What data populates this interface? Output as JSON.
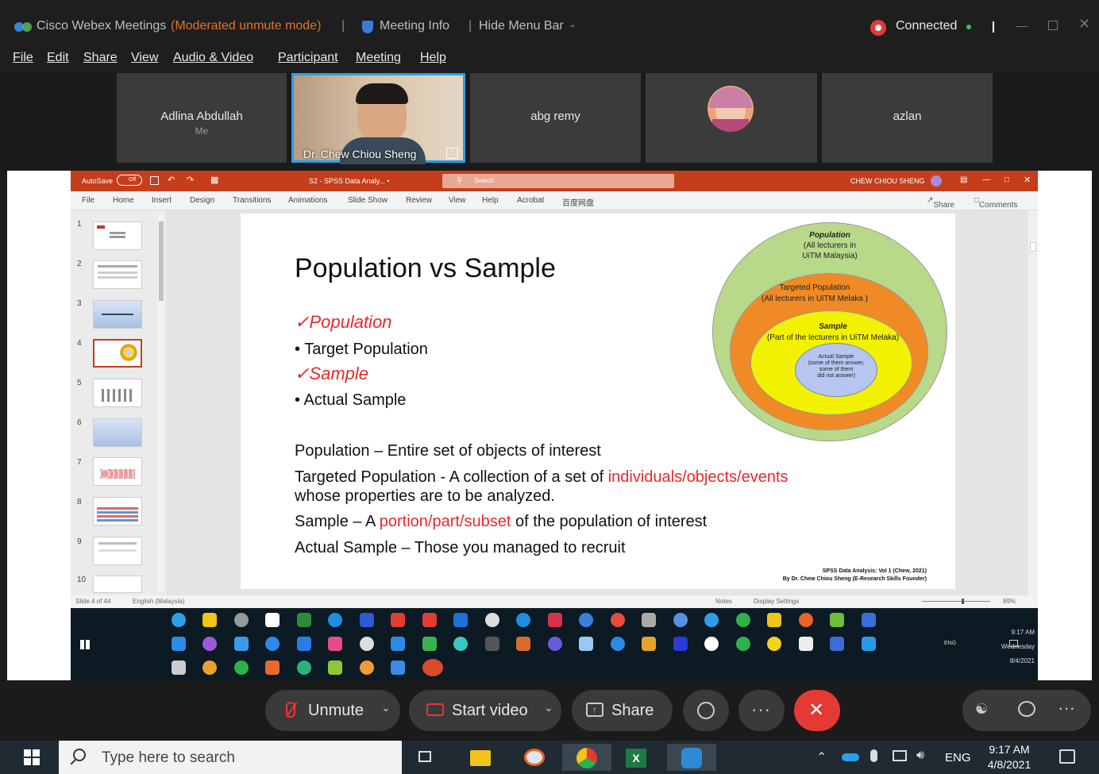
{
  "window": {
    "app_title": "Cisco Webex Meetings",
    "mode": "(Moderated unmute mode)",
    "meeting_info": "Meeting Info",
    "hide_menu_bar": "Hide Menu Bar",
    "connected": "Connected"
  },
  "menu": [
    "File",
    "Edit",
    "Share",
    "View",
    "Audio & Video",
    "Participant",
    "Meeting",
    "Help"
  ],
  "participants": [
    {
      "name": "Adlina Abdullah",
      "sub": "Me"
    },
    {
      "name": "Dr. Chew Chiou Sheng",
      "sub": ""
    },
    {
      "name": "abg remy",
      "sub": ""
    },
    {
      "name": "",
      "sub": ""
    },
    {
      "name": "azlan",
      "sub": ""
    }
  ],
  "powerpoint": {
    "autosave": "AutoSave",
    "autosave_state": "Off",
    "doc_title": "S2 - SPSS Data Analy... •",
    "search": "Search",
    "user": "CHEW CHIOU SHENG",
    "share": "Share",
    "comments": "Comments",
    "ribbon": [
      "File",
      "Home",
      "Insert",
      "Design",
      "Transitions",
      "Animations",
      "Slide Show",
      "Review",
      "View",
      "Help",
      "Acrobat",
      "百度网盘"
    ],
    "thumb_numbers": [
      "1",
      "2",
      "3",
      "4",
      "5",
      "6",
      "7",
      "8",
      "9",
      "10"
    ],
    "status_left": "Slide 4 of 44",
    "status_lang": "English (Malaysia)",
    "status_notes": "Notes",
    "status_display": "Display Settings",
    "zoom": "89%"
  },
  "slide": {
    "title": "Population vs Sample",
    "bullets": [
      {
        "mark": "✓",
        "text": "Population"
      },
      {
        "mark": "•",
        "text": "Target Population"
      },
      {
        "mark": "✓",
        "text": "Sample"
      },
      {
        "mark": "•",
        "text": "Actual Sample"
      }
    ],
    "def1": "Population – Entire set of objects of interest",
    "def2_a": "Targeted Population - A collection of a set of ",
    "def2_red": "individuals/objects/events",
    "def2_b": "whose properties are to be analyzed.",
    "def3_a": "Sample – A ",
    "def3_red": "portion/part/subset",
    "def3_b": " of the population of interest",
    "def4": "Actual Sample – Those you managed to recruit",
    "credit1": "SPSS Data Analysis: Vol 1 (Chew, 2021)",
    "credit2": "By Dr. Chew Chiou Sheng (E-Research Skills Founder)",
    "circle1_title": "Population",
    "circle1_sub1": "(All lecturers in",
    "circle1_sub2": "UiTM Malaysia)",
    "circle2_l1": "Targeted Population",
    "circle2_l2": "(All lecturers in UiTM Melaka )",
    "circle3_title": "Sample",
    "circle3_sub": "(Part of the lecturers in UiTM Melaka)",
    "circle4_l1": "Actual Sample",
    "circle4_l2": "(some of them answer,",
    "circle4_l3": "some of them",
    "circle4_l4": "did not answer)"
  },
  "remote_tray": {
    "time": "9:17 AM",
    "day": "Wednesday",
    "date": "8/4/2021",
    "lang": "ENG"
  },
  "controls": {
    "unmute": "Unmute",
    "start_video": "Start video",
    "share": "Share"
  },
  "taskbar": {
    "search_placeholder": "Type here to search",
    "lang": "ENG",
    "time": "9:17 AM",
    "date": "4/8/2021"
  },
  "colors": {
    "accent_red": "#e53935",
    "slide_red": "#e8282b",
    "ppt_orange": "#c43e1c",
    "webex_blue": "#27a0e8"
  }
}
